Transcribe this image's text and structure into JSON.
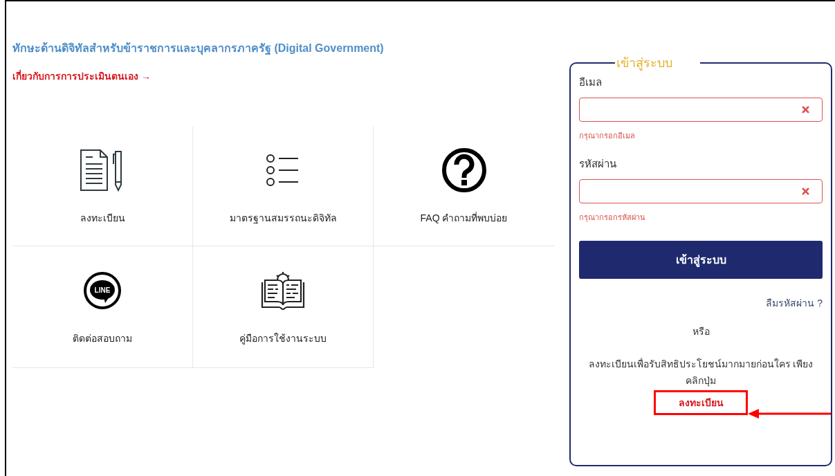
{
  "header": {
    "title": "ทักษะด้านดิจิทัลสำหรับข้าราชการและบุคลากรภาครัฐ (Digital Government)",
    "about_link": "เกี่ยวกับการการประเมินตนเอง",
    "about_arrow": "→"
  },
  "menu": [
    {
      "kind": "register",
      "label": "ลงทะเบียน"
    },
    {
      "kind": "standards",
      "label": "มาตรฐานสมรรถนะดิจิทัล"
    },
    {
      "kind": "faq",
      "label": "FAQ คำถามที่พบบ่อย"
    },
    {
      "kind": "line",
      "label": "ติดต่อสอบถาม",
      "icon_text": "LINE"
    },
    {
      "kind": "manual",
      "label": "คู่มือการใช้งานระบบ"
    }
  ],
  "login": {
    "legend": "เข้าสู่ระบบ",
    "fields": [
      {
        "label": "อีเมล",
        "invalid": true,
        "error": "กรุณากรอกอีเมล"
      },
      {
        "label": "รหัสผ่าน",
        "invalid": true,
        "error": "กรุณากรอกรหัสผ่าน"
      }
    ],
    "submit": "เข้าสู่ระบบ",
    "forgot": "ลืมรหัสผ่าน ?",
    "or": "หรือ",
    "register_prompt": "ลงทะเบียนเพื่อรับสิทธิประโยชน์มากมายก่อนใคร เพียงคลิกปุ่ม",
    "register_link": {
      "label": "ลงทะเบียน",
      "highlighted": true
    }
  }
}
